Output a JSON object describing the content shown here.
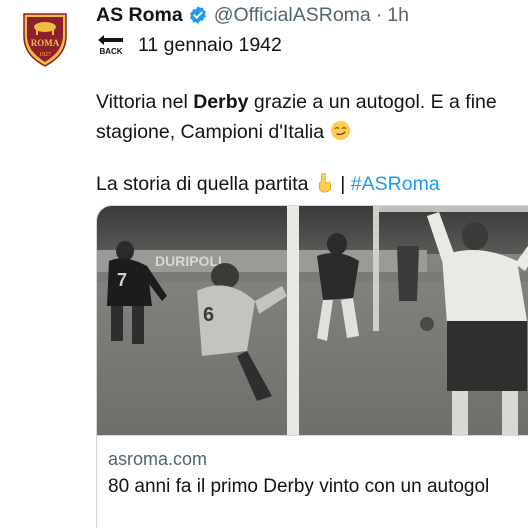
{
  "author": {
    "name": "AS Roma",
    "handle": "@OfficialASRoma",
    "separator": "·",
    "time": "1h",
    "avatar_icon": "roma-crest-icon",
    "avatar_text": "ROMA",
    "avatar_year": "1927"
  },
  "tweet": {
    "back_icon_label": "BACK",
    "date_line": "11 gennaio 1942",
    "line2_a": "Vittoria nel ",
    "line2_bold": "Derby",
    "line2_b": " grazie a un autogol. E a fine stagione, Campioni d'Italia",
    "line4_a": "La storia di quella partita",
    "line4_sep": " | ",
    "hashtag": "#ASRoma",
    "emoji_smirk": "smirk-emoji-icon",
    "emoji_point_down": "pointing-down-emoji-icon"
  },
  "card": {
    "image_alt": "match-photo",
    "photo_banner_text": "DURIPOLI",
    "domain": "asroma.com",
    "title": "80 anni fa il primo Derby vinto con un autogol"
  },
  "colors": {
    "accent": "#1d9bf0",
    "crest_red": "#8e1f2f",
    "crest_gold": "#f0bc42"
  }
}
